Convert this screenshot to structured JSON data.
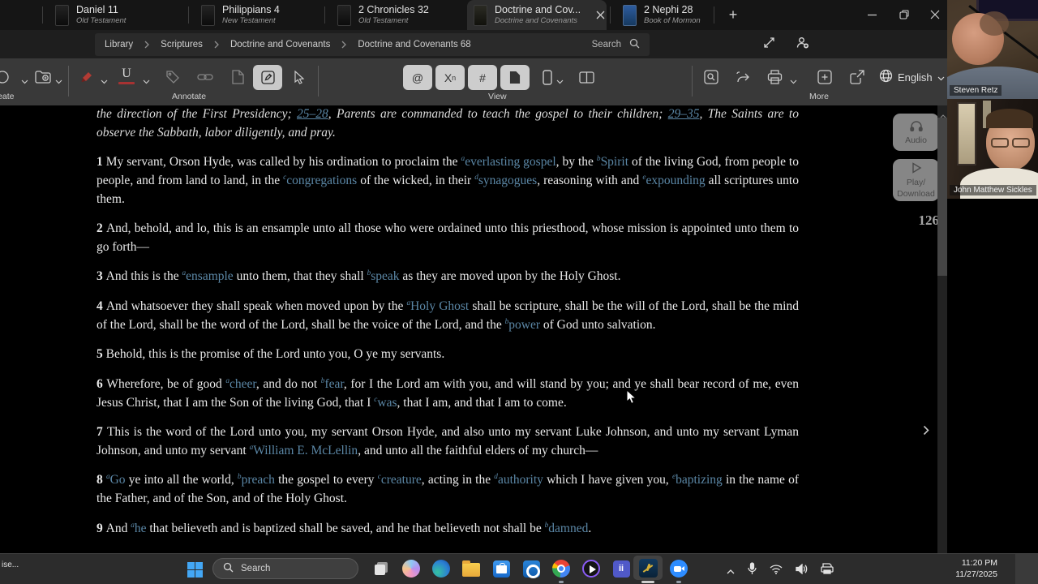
{
  "tabs": [
    {
      "title": "Daniel 11",
      "subtitle": "Old Testament"
    },
    {
      "title": "Philippians 4",
      "subtitle": "New Testament"
    },
    {
      "title": "2 Chronicles 32",
      "subtitle": "Old Testament"
    },
    {
      "title": "Doctrine and Cov...",
      "subtitle": "Doctrine and Covenants"
    },
    {
      "title": "2 Nephi 28",
      "subtitle": "Book of Mormon"
    }
  ],
  "tabbar": {
    "new_tab_glyph": "+"
  },
  "breadcrumb": [
    "Library",
    "Scriptures",
    "Doctrine and Covenants",
    "Doctrine and Covenants 68"
  ],
  "search_label": "Search",
  "toolbar": {
    "groups": {
      "create": "Create",
      "annotate": "Annotate",
      "view": "View",
      "more": "More"
    },
    "underline_char": "U",
    "view_buttons": {
      "at": "@",
      "x": "X",
      "n": "n",
      "hash": "#"
    },
    "language": "English"
  },
  "content": {
    "intro_segments": [
      {
        "t": "the direction of the First Presidency; "
      },
      {
        "ref": "25–28"
      },
      {
        "t": ", Parents are commanded to teach the gospel to their children; "
      },
      {
        "ref": "29–35"
      },
      {
        "t": ", The Saints are to observe the Sabbath, labor diligently, and pray."
      }
    ],
    "verses": [
      {
        "num": "1",
        "segments": [
          {
            "t": "My servant, Orson Hyde, was called by his ordination to proclaim the "
          },
          {
            "sup": "a",
            "link": "everlasting gospel"
          },
          {
            "t": ", by the "
          },
          {
            "sup": "b",
            "link": "Spirit"
          },
          {
            "t": " of the living God, from people to people, and from land to land, in the "
          },
          {
            "sup": "c",
            "link": "congregations"
          },
          {
            "t": " of the wicked, in their "
          },
          {
            "sup": "d",
            "link": "synagogues"
          },
          {
            "t": ", reasoning with and "
          },
          {
            "sup": "e",
            "link": "expounding"
          },
          {
            "t": " all scriptures unto them."
          }
        ]
      },
      {
        "num": "2",
        "segments": [
          {
            "t": "And, behold, and lo, this is an ensample unto all those who were ordained unto this priesthood, whose mission is appointed unto them to go forth—"
          }
        ]
      },
      {
        "num": "3",
        "segments": [
          {
            "t": "And this is the "
          },
          {
            "sup": "a",
            "link": "ensample"
          },
          {
            "t": " unto them, that they shall "
          },
          {
            "sup": "b",
            "link": "speak"
          },
          {
            "t": " as they are moved upon by the Holy Ghost."
          }
        ]
      },
      {
        "num": "4",
        "segments": [
          {
            "t": "And whatsoever they shall speak when moved upon by the "
          },
          {
            "sup": "a",
            "link": "Holy Ghost"
          },
          {
            "t": " shall be scripture, shall be the will of the Lord, shall be the mind of the Lord, shall be the word of the Lord, shall be the voice of the Lord, and the "
          },
          {
            "sup": "b",
            "link": "power"
          },
          {
            "t": " of God unto salvation."
          }
        ]
      },
      {
        "num": "5",
        "segments": [
          {
            "t": "Behold, this is the promise of the Lord unto you, O ye my servants."
          }
        ]
      },
      {
        "num": "6",
        "segments": [
          {
            "t": "Wherefore, be of good "
          },
          {
            "sup": "a",
            "link": "cheer"
          },
          {
            "t": ", and do not "
          },
          {
            "sup": "b",
            "link": "fear"
          },
          {
            "t": ", for I the Lord am with you, and will stand by you; and ye shall bear record of me, even Jesus Christ, that I am the Son of the living God, that I "
          },
          {
            "sup": "c",
            "link": "was"
          },
          {
            "t": ", that I am, and that I am to come."
          }
        ]
      },
      {
        "num": "7",
        "segments": [
          {
            "t": "This is the word of the Lord unto you, my servant Orson Hyde, and also unto my servant Luke Johnson, and unto my servant Lyman Johnson, and unto my servant "
          },
          {
            "sup": "a",
            "link": "William E. McLellin"
          },
          {
            "t": ", and unto all the faithful elders of my church—"
          }
        ]
      },
      {
        "num": "8",
        "segments": [
          {
            "sup": "a",
            "link": "Go"
          },
          {
            "t": " ye into all the world, "
          },
          {
            "sup": "b",
            "link": "preach"
          },
          {
            "t": " the gospel to every "
          },
          {
            "sup": "c",
            "link": "creature"
          },
          {
            "t": ", acting in the "
          },
          {
            "sup": "d",
            "link": "authority"
          },
          {
            "t": " which I have given you, "
          },
          {
            "sup": "e",
            "link": "baptizing"
          },
          {
            "t": " in the name of the Father, and of the Son, and of the Holy Ghost."
          }
        ]
      },
      {
        "num": "9",
        "segments": [
          {
            "t": "And "
          },
          {
            "sup": "a",
            "link": "he"
          },
          {
            "t": " that believeth and is baptized shall be saved, and he that believeth not shall be "
          },
          {
            "sup": "b",
            "link": "damned"
          },
          {
            "t": "."
          }
        ]
      }
    ]
  },
  "side": {
    "audio_label": "Audio",
    "play_line1": "Play/",
    "play_line2": "Download",
    "page_number": "126",
    "next_glyph": "›"
  },
  "webcam": {
    "participants": [
      {
        "name": "Steven Retz"
      },
      {
        "name": "John Matthew Sickles"
      }
    ]
  },
  "taskbar": {
    "left_text": "ise...",
    "search_placeholder": "Search",
    "teams_glyph": "ii",
    "time": "11:20 PM",
    "date": "11/27/2025"
  },
  "colors": {
    "link_blue": "#5b87a6",
    "toolbar_bg": "#393939",
    "content_bg": "#000000",
    "accent_red": "#a63232"
  }
}
